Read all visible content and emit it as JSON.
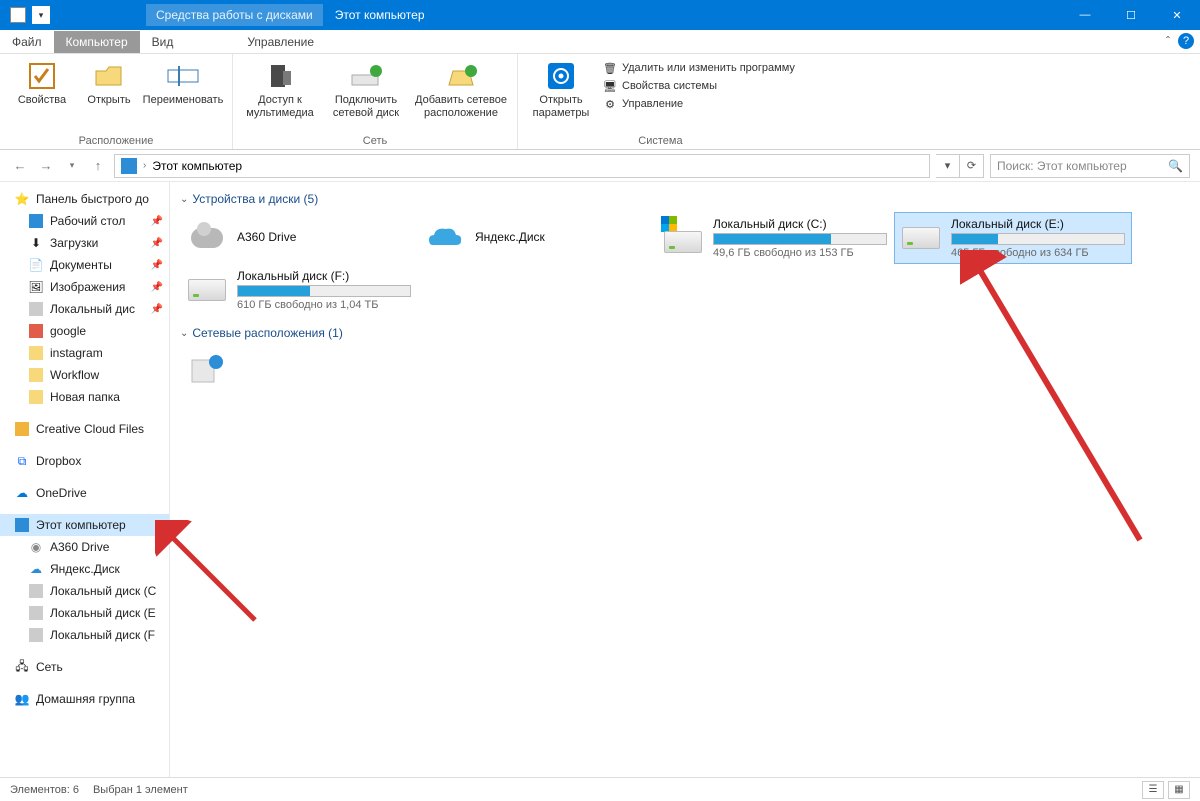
{
  "titlebar": {
    "context_tab": "Средства работы с дисками",
    "app_title": "Этот компьютер"
  },
  "tabs": {
    "file": "Файл",
    "computer": "Компьютер",
    "view": "Вид",
    "manage": "Управление"
  },
  "ribbon": {
    "properties": "Свойства",
    "open": "Открыть",
    "rename": "Переименовать",
    "group_location": "Расположение",
    "media_access": "Доступ к\nмультимедиа",
    "map_drive": "Подключить\nсетевой диск",
    "add_network": "Добавить сетевое\nрасположение",
    "group_network": "Сеть",
    "open_settings": "Открыть\nпараметры",
    "sys_remove": "Удалить или изменить программу",
    "sys_props": "Свойства системы",
    "sys_manage": "Управление",
    "group_system": "Система"
  },
  "breadcrumb": {
    "location": "Этот компьютер",
    "search_placeholder": "Поиск: Этот компьютер"
  },
  "sidebar": {
    "quick_access": "Панель быстрого до",
    "desktop": "Рабочий стол",
    "downloads": "Загрузки",
    "documents": "Документы",
    "pictures": "Изображения",
    "local_disk": "Локальный дис",
    "google": "google",
    "instagram": "instagram",
    "workflow": "Workflow",
    "new_folder": "Новая папка",
    "creative_cloud": "Creative Cloud Files",
    "dropbox": "Dropbox",
    "onedrive": "OneDrive",
    "this_pc": "Этот компьютер",
    "a360": "A360 Drive",
    "yandex": "Яндекс.Диск",
    "local_c": "Локальный диск (С",
    "local_e": "Локальный диск (Е",
    "local_f": "Локальный диск (F",
    "network": "Сеть",
    "homegroup": "Домашняя группа"
  },
  "sections": {
    "devices": "Устройства и диски (5)",
    "network_loc": "Сетевые расположения (1)"
  },
  "drives": {
    "a360": {
      "name": "A360 Drive"
    },
    "yandex": {
      "name": "Яндекс.Диск"
    },
    "c": {
      "name": "Локальный диск (C:)",
      "free": "49,6 ГБ свободно из 153 ГБ",
      "fill_pct": 68
    },
    "e": {
      "name": "Локальный диск (E:)",
      "free": "465 ГБ свободно из 634 ГБ",
      "fill_pct": 27
    },
    "f": {
      "name": "Локальный диск (F:)",
      "free": "610 ГБ свободно из 1,04 ТБ",
      "fill_pct": 42
    }
  },
  "status": {
    "items": "Элементов: 6",
    "selected": "Выбран 1 элемент"
  }
}
